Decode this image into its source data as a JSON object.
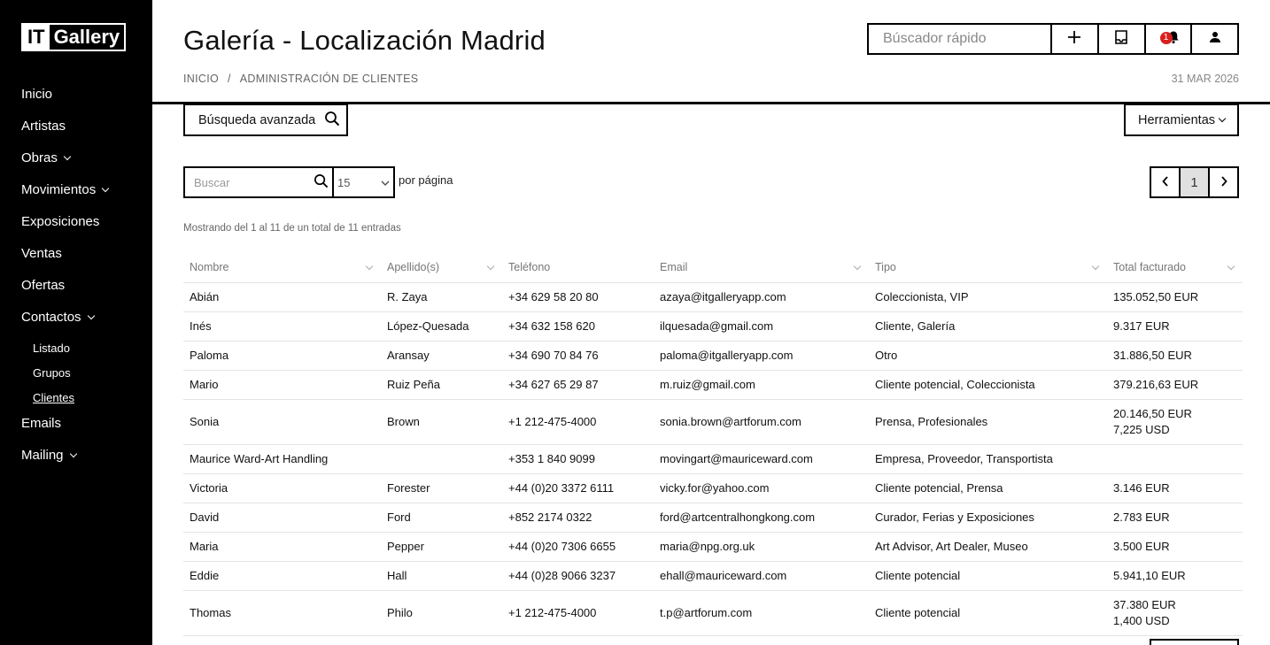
{
  "app": {
    "logo_it": "IT",
    "logo_gallery": "Gallery"
  },
  "sidebar": {
    "items": [
      {
        "label": "Inicio",
        "expandable": false
      },
      {
        "label": "Artistas",
        "expandable": false
      },
      {
        "label": "Obras",
        "expandable": true
      },
      {
        "label": "Movimientos",
        "expandable": true
      },
      {
        "label": "Exposiciones",
        "expandable": false
      },
      {
        "label": "Ventas",
        "expandable": false
      },
      {
        "label": "Ofertas",
        "expandable": false
      },
      {
        "label": "Contactos",
        "expandable": true
      }
    ],
    "contactos_sub": [
      {
        "label": "Listado"
      },
      {
        "label": "Grupos"
      },
      {
        "label": "Clientes",
        "active": true
      }
    ],
    "items_after": [
      {
        "label": "Emails",
        "expandable": false
      },
      {
        "label": "Mailing",
        "expandable": true
      }
    ]
  },
  "header": {
    "title": "Galería - Localización Madrid",
    "breadcrumb": [
      "INICIO",
      "ADMINISTRACIÓN DE CLIENTES"
    ],
    "breadcrumb_sep": "/",
    "date": "31 MAR 2026",
    "quick_search_placeholder": "Búscador rápido",
    "notification_count": "1",
    "icons": [
      "plus-icon",
      "inbox-icon",
      "bell-icon",
      "user-icon"
    ]
  },
  "toolbar": {
    "advanced_search_label": "Búsqueda avanzada",
    "tools_label": "Herramientas",
    "search_placeholder": "Buscar",
    "per_page_value": "15",
    "per_page_label": "por página",
    "current_page": "1",
    "info_text": "Mostrando del 1 al 11 de un total de 11 entradas"
  },
  "table": {
    "columns": [
      "Nombre",
      "Apellido(s)",
      "Teléfono",
      "Email",
      "Tipo",
      "Total facturado"
    ],
    "rows": [
      [
        "Abián",
        "R. Zaya",
        "+34 629 58 20 80",
        "azaya@itgalleryapp.com",
        "Coleccionista, VIP",
        "135.052,50 EUR",
        ""
      ],
      [
        "Inés",
        "López-Quesada",
        "+34 632 158 620",
        "ilquesada@gmail.com",
        "Cliente, Galería",
        "9.317 EUR",
        ""
      ],
      [
        "Paloma",
        "Aransay",
        "+34 690 70 84 76",
        "paloma@itgalleryapp.com",
        "Otro",
        "31.886,50 EUR",
        ""
      ],
      [
        "Mario",
        "Ruiz Peña",
        "+34 627 65 29 87",
        "m.ruiz@gmail.com",
        "Cliente potencial, Coleccionista",
        "379.216,63 EUR",
        ""
      ],
      [
        "Sonia",
        "Brown",
        "+1 212-475-4000",
        "sonia.brown@artforum.com",
        "Prensa, Profesionales",
        "20.146,50 EUR",
        "7,225 USD"
      ],
      [
        "Maurice Ward-Art Handling",
        "",
        "+353 1 840 9099",
        "movingart@mauriceward.com",
        "Empresa, Proveedor, Transportista",
        "",
        ""
      ],
      [
        "Victoria",
        "Forester",
        "+44 (0)20 3372 6111",
        "vicky.for@yahoo.com",
        "Cliente potencial, Prensa",
        "3.146 EUR",
        ""
      ],
      [
        "David",
        "Ford",
        "+852 2174 0322",
        "ford@artcentralhongkong.com",
        "Curador, Ferias y Exposiciones",
        "2.783 EUR",
        ""
      ],
      [
        "Maria",
        "Pepper",
        "+44 (0)20 7306 6655",
        "maria@npg.org.uk",
        "Art Advisor, Art Dealer, Museo",
        "3.500 EUR",
        ""
      ],
      [
        "Eddie",
        "Hall",
        "+44 (0)28 9066 3237",
        "ehall@mauriceward.com",
        "Cliente potencial",
        "5.941,10 EUR",
        ""
      ],
      [
        "Thomas",
        "Philo",
        "+1 212-475-4000",
        "t.p@artforum.com",
        "Cliente potencial",
        "37.380 EUR",
        "1,400 USD"
      ]
    ]
  }
}
